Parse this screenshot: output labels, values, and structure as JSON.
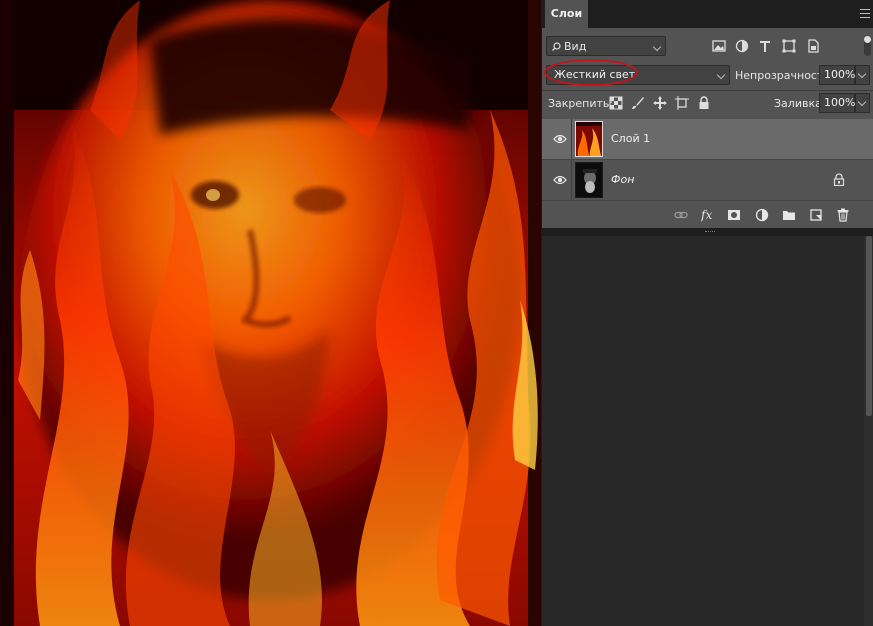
{
  "canvas": {
    "image_subject": "face-engulfed-in-flames-composite",
    "colors": {
      "deep": "#3a0000",
      "red": "#d41400",
      "orange": "#ff5a00",
      "yellow": "#ffb020"
    }
  },
  "panel": {
    "tab_label": "Слои",
    "filter": {
      "label": "Вид",
      "icon": "search-icon"
    },
    "filter_icons": [
      "image-filter-icon",
      "adjustment-filter-icon",
      "type-filter-icon",
      "shape-filter-icon",
      "smart-object-filter-icon"
    ],
    "blend_mode": "Жесткий свет",
    "opacity": {
      "label": "Непрозрачность:",
      "value": "100%"
    },
    "lock": {
      "label": "Закрепить:",
      "icons": [
        "lock-transparent-pixels-icon",
        "lock-image-pixels-icon",
        "lock-position-icon",
        "lock-artboard-icon",
        "lock-all-icon"
      ]
    },
    "fill": {
      "label": "Заливка:",
      "value": "100%"
    },
    "layers": [
      {
        "name": "Слой 1",
        "visible": true,
        "selected": true,
        "locked": false
      },
      {
        "name": "Фон",
        "visible": true,
        "selected": false,
        "locked": true
      }
    ],
    "bottom_icons": [
      "link-layers-icon",
      "fx-icon",
      "add-mask-icon",
      "new-adjustment-icon",
      "new-group-icon",
      "new-layer-icon",
      "delete-icon"
    ],
    "accent_highlight": "#c4151c"
  }
}
